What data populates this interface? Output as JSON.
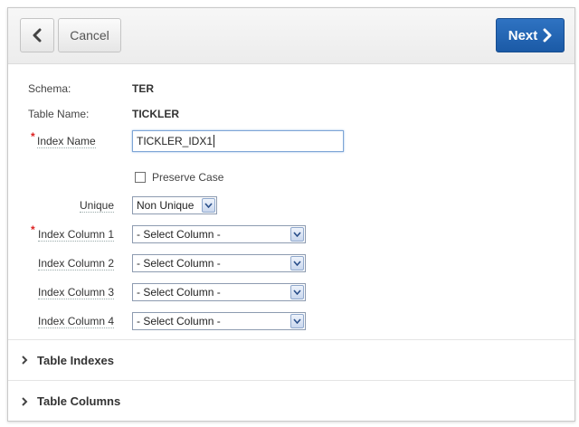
{
  "toolbar": {
    "back_icon": "chevron-left-icon",
    "cancel_label": "Cancel",
    "next_label": "Next",
    "next_icon": "chevron-right-icon",
    "next_color": "#1f5fae"
  },
  "form": {
    "schema": {
      "label": "Schema:",
      "value": "TER"
    },
    "table_name": {
      "label": "Table Name:",
      "value": "TICKLER"
    },
    "index_name": {
      "label": "Index Name",
      "value": "TICKLER_IDX1",
      "required": true
    },
    "preserve_case": {
      "label": "Preserve Case",
      "checked": false
    },
    "unique": {
      "label": "Unique",
      "selected": "Non Unique"
    },
    "index_columns": [
      {
        "label": "Index Column 1",
        "selected": "- Select Column -",
        "required": true
      },
      {
        "label": "Index Column 2",
        "selected": "- Select Column -",
        "required": false
      },
      {
        "label": "Index Column 3",
        "selected": "- Select Column -",
        "required": false
      },
      {
        "label": "Index Column 4",
        "selected": "- Select Column -",
        "required": false
      }
    ],
    "required_marker": "*"
  },
  "sections": [
    {
      "title": "Table Indexes",
      "expanded": false
    },
    {
      "title": "Table Columns",
      "expanded": false
    }
  ],
  "colors": {
    "required": "#dd2222",
    "focus_border": "#7ea6d6"
  }
}
